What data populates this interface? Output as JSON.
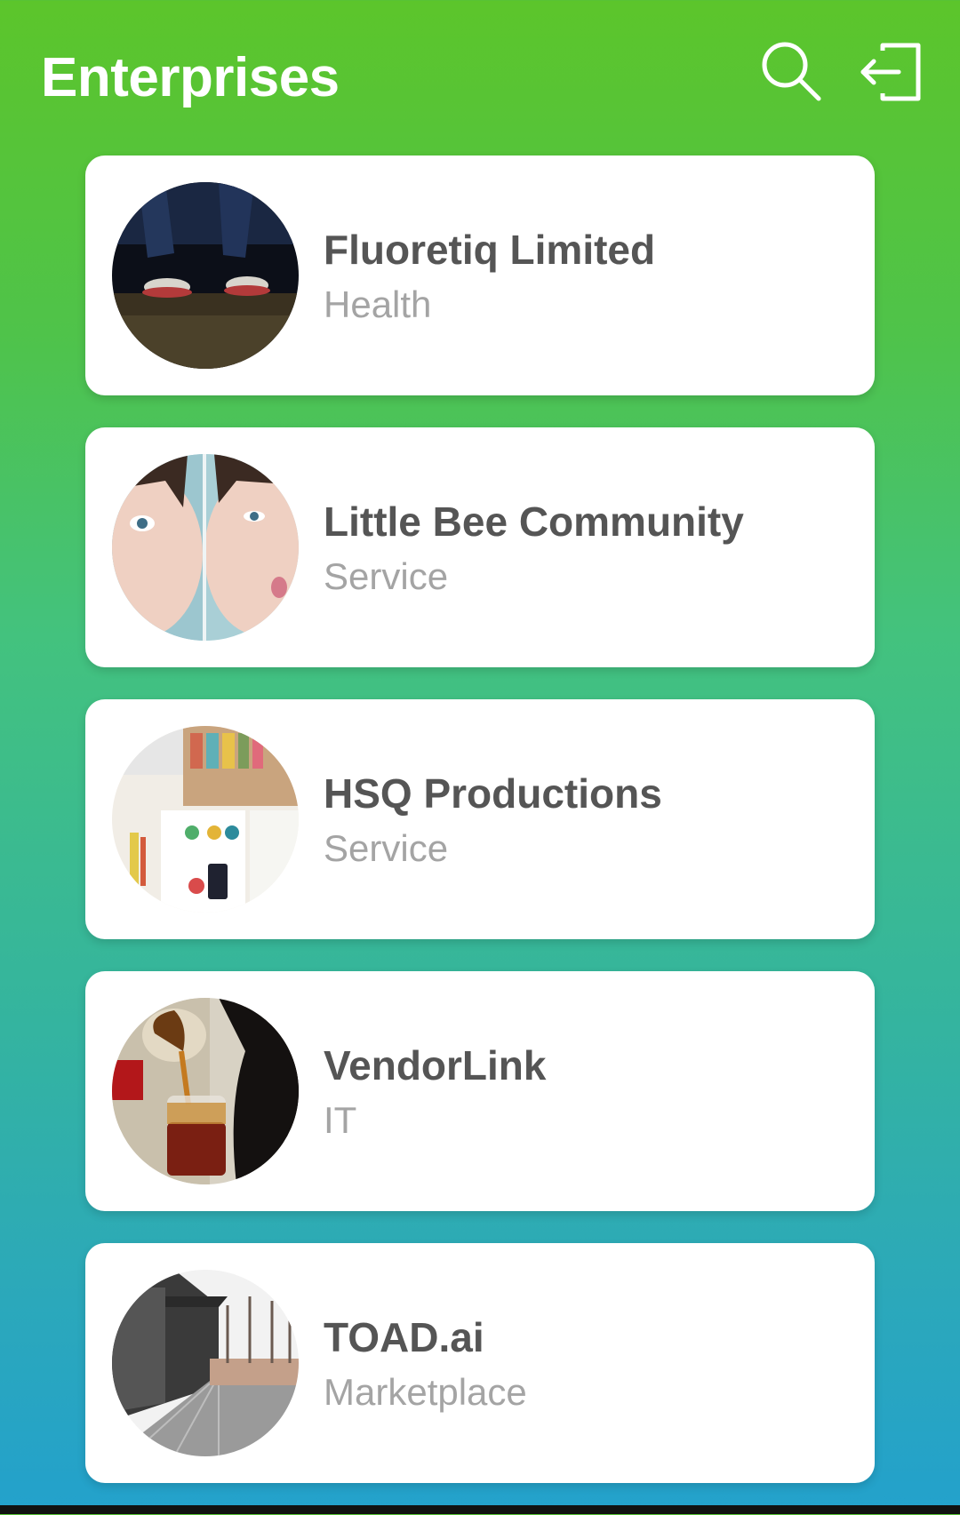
{
  "header": {
    "title": "Enterprises",
    "search_icon": "search-icon",
    "logout_icon": "logout-icon"
  },
  "enterprises": [
    {
      "name": "Fluoretiq Limited",
      "category": "Health",
      "avatar": "sneakers-photo"
    },
    {
      "name": "Little Bee Community",
      "category": "Service",
      "avatar": "mirrored-face-photo"
    },
    {
      "name": "HSQ Productions",
      "category": "Service",
      "avatar": "desk-flatlay-photo"
    },
    {
      "name": "VendorLink",
      "category": "IT",
      "avatar": "pouring-coffee-photo"
    },
    {
      "name": "TOAD.ai",
      "category": "Marketplace",
      "avatar": "building-walkway-photo"
    }
  ],
  "colors": {
    "gradient_top": "#5cc52b",
    "gradient_bottom": "#23a1cc",
    "card_background": "#ffffff",
    "name_text": "#555555",
    "category_text": "#a4a4a4"
  }
}
